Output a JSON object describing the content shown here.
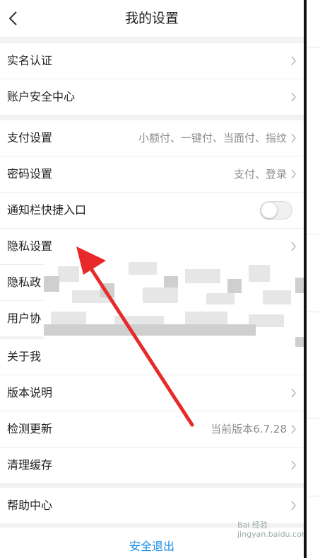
{
  "header": {
    "title": "我的设置"
  },
  "groups": [
    {
      "rows": [
        {
          "label": "实名认证",
          "value": ""
        },
        {
          "label": "账户安全中心",
          "value": ""
        }
      ]
    },
    {
      "rows": [
        {
          "label": "支付设置",
          "value": "小额付、一键付、当面付、指纹"
        },
        {
          "label": "密码设置",
          "value": "支付、登录"
        },
        {
          "label": "通知栏快捷入口",
          "value": ""
        },
        {
          "label": "隐私设置",
          "value": ""
        },
        {
          "label": "隐私政",
          "value": ""
        },
        {
          "label": "用户协",
          "value": ""
        }
      ]
    },
    {
      "rows": [
        {
          "label": "关于我",
          "value": ""
        },
        {
          "label": "版本说明",
          "value": ""
        },
        {
          "label": "检测更新",
          "value": "当前版本6.7.28"
        },
        {
          "label": "清理缓存",
          "value": ""
        }
      ]
    },
    {
      "rows": [
        {
          "label": "帮助中心",
          "value": ""
        }
      ]
    }
  ],
  "notification_toggle": {
    "on": false
  },
  "logout": {
    "label": "安全退出"
  },
  "watermark": {
    "line1": "Bai 经验",
    "line2": "jingyan.baidu.com"
  },
  "colors": {
    "accent": "#1a8ee8",
    "annotation_arrow": "#e8292a"
  }
}
